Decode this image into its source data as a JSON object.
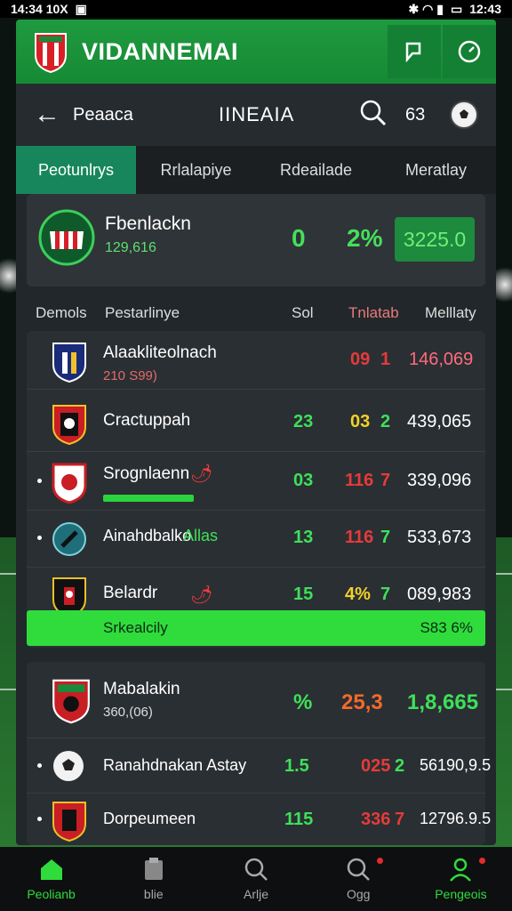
{
  "status_bar": {
    "time": "14:34 10X",
    "right": "12:43"
  },
  "header": {
    "app_title": "VIDANNEMAI"
  },
  "navrow": {
    "back_label": "Peaaca",
    "center_title": "IINEAIA",
    "count": "63"
  },
  "tabs": [
    "Peotunlrys",
    "Rrlalapiye",
    "Rdeailade",
    "Meratlay"
  ],
  "featured": {
    "name": "Fbenlackn",
    "sub": "129,616",
    "score": "0",
    "pct": "2%",
    "value": "3225.0"
  },
  "columns": {
    "c0": "Demols",
    "c1": "Pestarlinye",
    "c2": "Sol",
    "c3": "Tnlatab",
    "c4": "Melllaty"
  },
  "rows": [
    {
      "name": "Alaakliteolnach",
      "sub": "210 S99)",
      "v1": "09",
      "v2": "1",
      "v3": "146,069"
    },
    {
      "name": "Cractuppah",
      "sub": "",
      "v1": "23",
      "v2": "03",
      "v3": "2",
      "v4": "439,065"
    },
    {
      "name": "Srognlaenn",
      "sub": "",
      "v1": "03",
      "v2": "116",
      "v3": "7",
      "v4": "339,096"
    },
    {
      "name": "Ainahdbalko",
      "tag": "Allas",
      "v1": "13",
      "v2": "116",
      "v3": "7",
      "v4": "533,673"
    },
    {
      "name": "Belardr",
      "v1": "15",
      "v2": "4%",
      "v3": "7",
      "v4": "089,983"
    }
  ],
  "summary": {
    "label": "Srkealcily",
    "value": "S83 6%"
  },
  "rows2": [
    {
      "name": "Mabalakin",
      "sub": "360,(06)",
      "v1": "%",
      "v2": "25,3",
      "v3": "1,8,665"
    },
    {
      "name": "Ranahdnakan Astay",
      "v1": "1.5",
      "v2": "025",
      "v3": "2",
      "v4": "56190,9.5"
    },
    {
      "name": "Dorpeumeen",
      "v1": "115",
      "v2": "336",
      "v3": "7",
      "v4": "12796.9.5"
    }
  ],
  "bottom_nav": [
    {
      "label": "Peolianb",
      "icon": "home-icon"
    },
    {
      "label": "blie",
      "icon": "clipboard-icon"
    },
    {
      "label": "Arlje",
      "icon": "search-icon"
    },
    {
      "label": "Ogg",
      "icon": "search-icon"
    },
    {
      "label": "Pengeois",
      "icon": "user-icon"
    }
  ]
}
